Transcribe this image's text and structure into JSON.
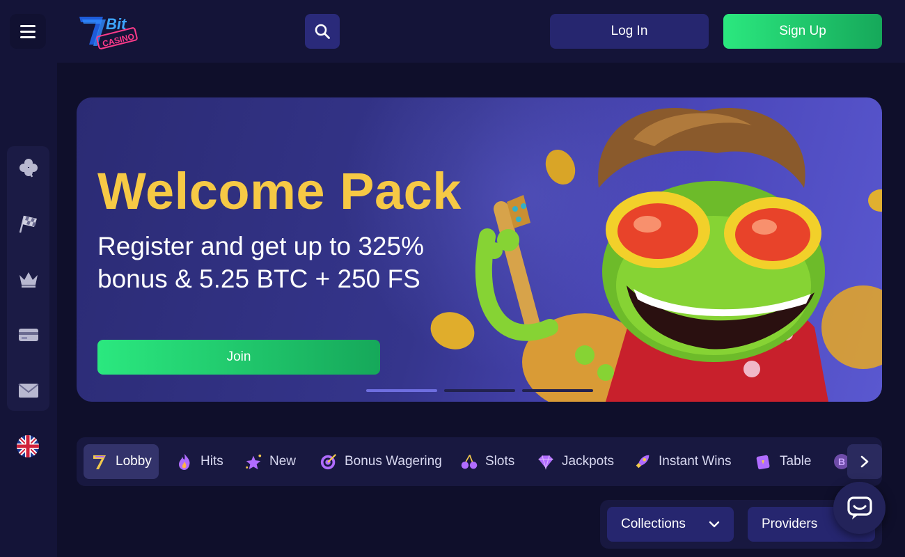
{
  "header": {
    "logo_alt": "7Bit Casino",
    "login_label": "Log In",
    "signup_label": "Sign Up"
  },
  "sidebar": {
    "items": [
      {
        "icon": "clover-icon"
      },
      {
        "icon": "racing-flag-icon"
      },
      {
        "icon": "crown-icon"
      },
      {
        "icon": "credit-card-icon"
      },
      {
        "icon": "envelope-icon"
      }
    ],
    "language": "uk-flag-icon"
  },
  "hero": {
    "title": "Welcome Pack",
    "subtitle": "Register and get up to 325% bonus & 5.25 BTC + 250 FS",
    "join_label": "Join",
    "slides": 3,
    "active_slide": 1
  },
  "categories": {
    "items": [
      {
        "label": "Lobby",
        "icon": "seven-icon",
        "active": true
      },
      {
        "label": "Hits",
        "icon": "flame-icon",
        "active": false
      },
      {
        "label": "New",
        "icon": "sparkle-star-icon",
        "active": false
      },
      {
        "label": "Bonus Wagering",
        "icon": "target-icon",
        "active": false
      },
      {
        "label": "Slots",
        "icon": "cherries-icon",
        "active": false
      },
      {
        "label": "Jackpots",
        "icon": "diamond-icon",
        "active": false
      },
      {
        "label": "Instant Wins",
        "icon": "rocket-icon",
        "active": false
      },
      {
        "label": "Table",
        "icon": "cards-icon",
        "active": false
      }
    ]
  },
  "filters": {
    "collections_label": "Collections",
    "providers_label": "Providers"
  },
  "colors": {
    "accent_green": "#2be87f",
    "title_yellow": "#f6c945",
    "background": "#0f0f2b"
  }
}
